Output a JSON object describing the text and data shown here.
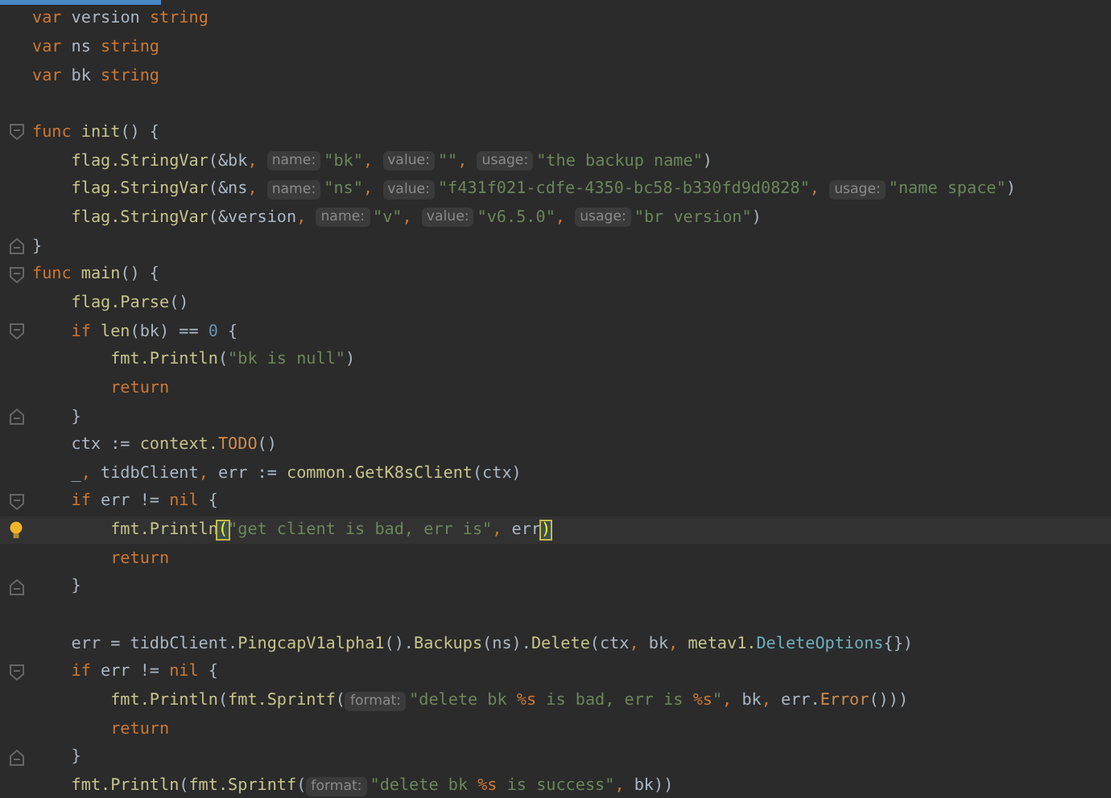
{
  "lines": [
    {
      "kind": "code",
      "tokens": [
        {
          "kind": "kw",
          "text": "var"
        },
        {
          "kind": "plain",
          "text": " version "
        },
        {
          "kind": "kw",
          "text": "string"
        }
      ]
    },
    {
      "kind": "code",
      "tokens": [
        {
          "kind": "kw",
          "text": "var"
        },
        {
          "kind": "plain",
          "text": " ns "
        },
        {
          "kind": "kw",
          "text": "string"
        }
      ]
    },
    {
      "kind": "code",
      "tokens": [
        {
          "kind": "kw",
          "text": "var"
        },
        {
          "kind": "plain",
          "text": " bk "
        },
        {
          "kind": "kw",
          "text": "string"
        }
      ]
    },
    {
      "kind": "blank"
    },
    {
      "kind": "code",
      "fold_start": true,
      "tokens": [
        {
          "kind": "kw",
          "text": "func "
        },
        {
          "kind": "call",
          "text": "init"
        },
        {
          "kind": "plain",
          "text": "() {"
        }
      ]
    },
    {
      "kind": "code",
      "tokens": [
        {
          "kind": "call",
          "text": "flag.StringVar"
        },
        {
          "kind": "plain",
          "text": "(&bk"
        },
        {
          "kind": "punct",
          "text": ", "
        },
        {
          "kind": "hint",
          "text": "name:"
        },
        {
          "kind": "str",
          "text": "\"bk\""
        },
        {
          "kind": "punct",
          "text": ", "
        },
        {
          "kind": "hint",
          "text": "value:"
        },
        {
          "kind": "str",
          "text": "\"\""
        },
        {
          "kind": "punct",
          "text": ", "
        },
        {
          "kind": "hint",
          "text": "usage:"
        },
        {
          "kind": "str",
          "text": "\"the backup name\""
        },
        {
          "kind": "plain",
          "text": ")"
        }
      ]
    },
    {
      "kind": "code",
      "tokens": [
        {
          "kind": "call",
          "text": "flag.StringVar"
        },
        {
          "kind": "plain",
          "text": "(&ns"
        },
        {
          "kind": "punct",
          "text": ", "
        },
        {
          "kind": "hint",
          "text": "name:"
        },
        {
          "kind": "str",
          "text": "\"ns\""
        },
        {
          "kind": "punct",
          "text": ", "
        },
        {
          "kind": "hint",
          "text": "value:"
        },
        {
          "kind": "str",
          "text": "\"f431f021-cdfe-4350-bc58-b330fd9d0828\""
        },
        {
          "kind": "punct",
          "text": ", "
        },
        {
          "kind": "hint",
          "text": "usage:"
        },
        {
          "kind": "str",
          "text": "\"name space\""
        },
        {
          "kind": "plain",
          "text": ")"
        }
      ]
    },
    {
      "kind": "code",
      "tokens": [
        {
          "kind": "call",
          "text": "flag.StringVar"
        },
        {
          "kind": "plain",
          "text": "(&version"
        },
        {
          "kind": "punct",
          "text": ", "
        },
        {
          "kind": "hint",
          "text": "name:"
        },
        {
          "kind": "str",
          "text": "\"v\""
        },
        {
          "kind": "punct",
          "text": ", "
        },
        {
          "kind": "hint",
          "text": "value:"
        },
        {
          "kind": "str",
          "text": "\"v6.5.0\""
        },
        {
          "kind": "punct",
          "text": ", "
        },
        {
          "kind": "hint",
          "text": "usage:"
        },
        {
          "kind": "str",
          "text": "\"br version\""
        },
        {
          "kind": "plain",
          "text": ")"
        }
      ]
    },
    {
      "kind": "code",
      "fold_end": true,
      "tokens": [
        {
          "kind": "plain",
          "text": "}"
        }
      ]
    },
    {
      "kind": "code",
      "fold_start": true,
      "tokens": [
        {
          "kind": "kw",
          "text": "func "
        },
        {
          "kind": "call",
          "text": "main"
        },
        {
          "kind": "plain",
          "text": "() {"
        }
      ]
    },
    {
      "kind": "code",
      "tokens": [
        {
          "kind": "call",
          "text": "flag.Parse"
        },
        {
          "kind": "plain",
          "text": "()"
        }
      ]
    },
    {
      "kind": "code",
      "fold_start": true,
      "tokens": [
        {
          "kind": "kw",
          "text": "if "
        },
        {
          "kind": "call",
          "text": "len"
        },
        {
          "kind": "plain",
          "text": "(bk) == "
        },
        {
          "kind": "num",
          "text": "0"
        },
        {
          "kind": "plain",
          "text": " {"
        }
      ]
    },
    {
      "kind": "code",
      "tokens": [
        {
          "kind": "call",
          "text": "fmt.Println"
        },
        {
          "kind": "plain",
          "text": "("
        },
        {
          "kind": "str",
          "text": "\"bk is null\""
        },
        {
          "kind": "plain",
          "text": ")"
        }
      ]
    },
    {
      "kind": "code",
      "tokens": [
        {
          "kind": "kw",
          "text": "return"
        }
      ]
    },
    {
      "kind": "code",
      "fold_end": true,
      "tokens": [
        {
          "kind": "plain",
          "text": "}"
        }
      ]
    },
    {
      "kind": "code",
      "tokens": [
        {
          "kind": "plain",
          "text": "ctx := "
        },
        {
          "kind": "call",
          "text": "context."
        },
        {
          "kind": "method",
          "text": "TODO"
        },
        {
          "kind": "plain",
          "text": "()"
        }
      ]
    },
    {
      "kind": "code",
      "tokens": [
        {
          "kind": "plain",
          "text": "_"
        },
        {
          "kind": "punct",
          "text": ", "
        },
        {
          "kind": "plain",
          "text": "tidbClient"
        },
        {
          "kind": "punct",
          "text": ", "
        },
        {
          "kind": "plain",
          "text": "err := "
        },
        {
          "kind": "call",
          "text": "common.GetK8sClient"
        },
        {
          "kind": "plain",
          "text": "(ctx)"
        }
      ]
    },
    {
      "kind": "code",
      "fold_start": true,
      "tokens": [
        {
          "kind": "kw",
          "text": "if"
        },
        {
          "kind": "plain",
          "text": " err != "
        },
        {
          "kind": "kw",
          "text": "nil"
        },
        {
          "kind": "plain",
          "text": " {"
        }
      ]
    },
    {
      "kind": "code",
      "current": true,
      "bulb": true,
      "tokens": [
        {
          "kind": "call",
          "text": "fmt.Println"
        },
        {
          "kind": "match",
          "text": "("
        },
        {
          "kind": "str",
          "text": "\"get client is bad, err is\""
        },
        {
          "kind": "punct",
          "text": ", "
        },
        {
          "kind": "plain",
          "text": "err"
        },
        {
          "kind": "match",
          "text": ")"
        }
      ]
    },
    {
      "kind": "code",
      "tokens": [
        {
          "kind": "kw",
          "text": "return"
        }
      ]
    },
    {
      "kind": "code",
      "fold_end": true,
      "tokens": [
        {
          "kind": "plain",
          "text": "}"
        }
      ]
    },
    {
      "kind": "blank"
    },
    {
      "kind": "code",
      "tokens": [
        {
          "kind": "plain",
          "text": "err = tidbClient."
        },
        {
          "kind": "call",
          "text": "PingcapV1alpha1"
        },
        {
          "kind": "plain",
          "text": "()."
        },
        {
          "kind": "call",
          "text": "Backups"
        },
        {
          "kind": "plain",
          "text": "(ns)."
        },
        {
          "kind": "call",
          "text": "Delete"
        },
        {
          "kind": "plain",
          "text": "(ctx"
        },
        {
          "kind": "punct",
          "text": ", "
        },
        {
          "kind": "plain",
          "text": "bk"
        },
        {
          "kind": "punct",
          "text": ", "
        },
        {
          "kind": "call",
          "text": "metav1."
        },
        {
          "kind": "type",
          "text": "DeleteOptions"
        },
        {
          "kind": "plain",
          "text": "{})"
        }
      ]
    },
    {
      "kind": "code",
      "fold_start": true,
      "tokens": [
        {
          "kind": "kw",
          "text": "if"
        },
        {
          "kind": "plain",
          "text": " err != "
        },
        {
          "kind": "kw",
          "text": "nil"
        },
        {
          "kind": "plain",
          "text": " {"
        }
      ]
    },
    {
      "kind": "code",
      "tokens": [
        {
          "kind": "call",
          "text": "fmt.Println"
        },
        {
          "kind": "plain",
          "text": "("
        },
        {
          "kind": "call",
          "text": "fmt.Sprintf"
        },
        {
          "kind": "plain",
          "text": "("
        },
        {
          "kind": "hint",
          "text": "format:"
        },
        {
          "kind": "str",
          "text": "\"delete bk "
        },
        {
          "kind": "esc",
          "text": "%s"
        },
        {
          "kind": "str",
          "text": " is bad, err is "
        },
        {
          "kind": "esc",
          "text": "%s"
        },
        {
          "kind": "str",
          "text": "\""
        },
        {
          "kind": "punct",
          "text": ", "
        },
        {
          "kind": "plain",
          "text": "bk"
        },
        {
          "kind": "punct",
          "text": ", "
        },
        {
          "kind": "plain",
          "text": "err."
        },
        {
          "kind": "method",
          "text": "Error"
        },
        {
          "kind": "plain",
          "text": "()))"
        }
      ]
    },
    {
      "kind": "code",
      "tokens": [
        {
          "kind": "kw",
          "text": "return"
        }
      ]
    },
    {
      "kind": "code",
      "fold_end": true,
      "tokens": [
        {
          "kind": "plain",
          "text": "}"
        }
      ]
    },
    {
      "kind": "code",
      "tokens": [
        {
          "kind": "call",
          "text": "fmt.Println"
        },
        {
          "kind": "plain",
          "text": "("
        },
        {
          "kind": "call",
          "text": "fmt.Sprintf"
        },
        {
          "kind": "plain",
          "text": "("
        },
        {
          "kind": "hint",
          "text": "format:"
        },
        {
          "kind": "str",
          "text": "\"delete bk "
        },
        {
          "kind": "esc",
          "text": "%s"
        },
        {
          "kind": "str",
          "text": " is success\""
        },
        {
          "kind": "punct",
          "text": ", "
        },
        {
          "kind": "plain",
          "text": "bk))"
        }
      ]
    }
  ]
}
